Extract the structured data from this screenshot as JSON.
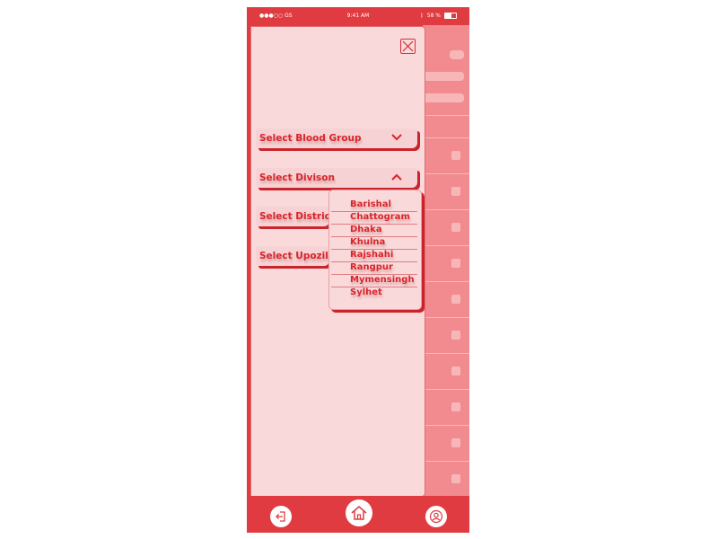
{
  "status_bar": {
    "carrier": "●●●○○ GS",
    "time": "9:41 AM",
    "battery": "58 %"
  },
  "drawer": {
    "close_icon": "close-icon",
    "selects": [
      {
        "label": "Select Blood Group",
        "state": "collapsed"
      },
      {
        "label": "Select Divison",
        "state": "expanded"
      },
      {
        "label": "Select District",
        "state": "collapsed"
      },
      {
        "label": "Select Upozila",
        "state": "collapsed"
      }
    ],
    "division_options": [
      "Barishal",
      "Chattogram",
      "Dhaka",
      "Khulna",
      "Rajshahi",
      "Rangpur",
      "Mymensingh",
      "Sylhet"
    ]
  },
  "bottom_nav": {
    "items": [
      {
        "icon": "logout-icon"
      },
      {
        "icon": "home-icon"
      },
      {
        "icon": "profile-icon"
      }
    ]
  },
  "colors": {
    "primary": "#e03b40",
    "drawer_bg": "#f9d9da",
    "text": "#d9242b",
    "shadow": "#c9242b"
  }
}
